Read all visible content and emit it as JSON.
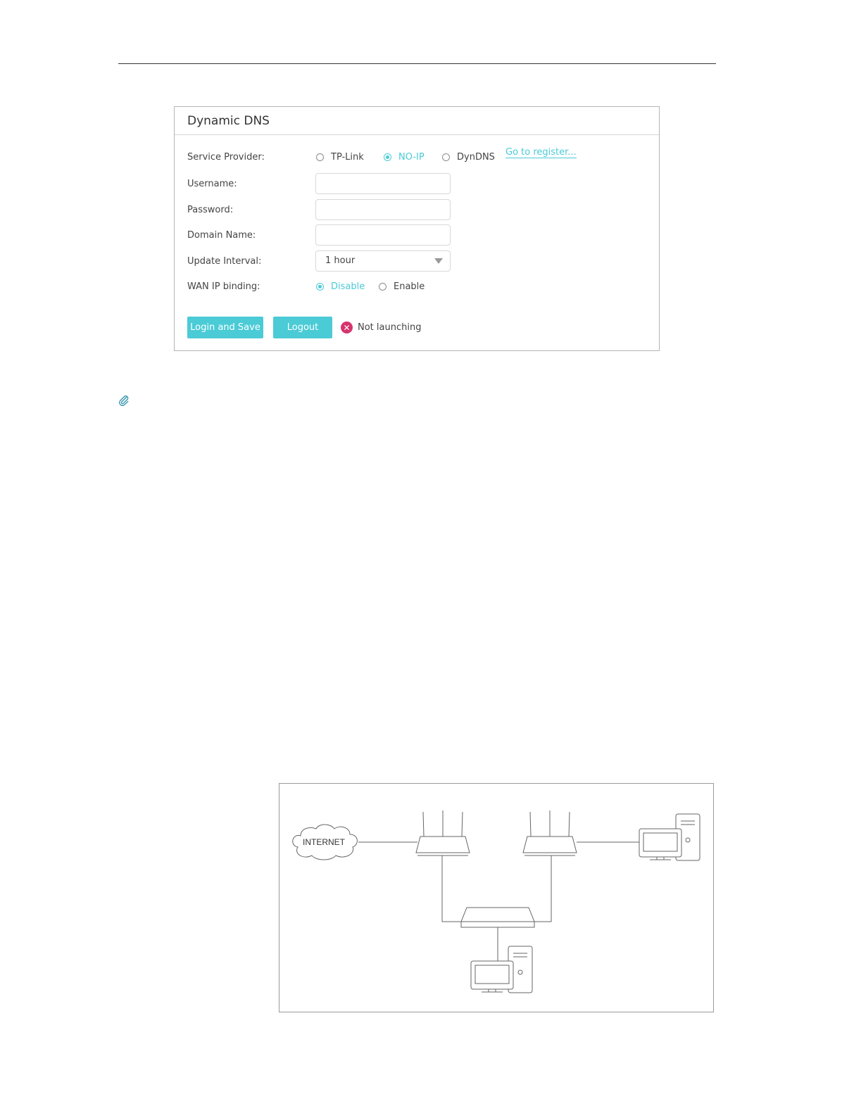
{
  "panel": {
    "title": "Dynamic DNS",
    "service_provider": {
      "label": "Service Provider:",
      "options": [
        "TP-Link",
        "NO-IP",
        "DynDNS"
      ],
      "selected": "NO-IP",
      "register_link": "Go to register..."
    },
    "username": {
      "label": "Username:",
      "value": ""
    },
    "password": {
      "label": "Password:",
      "value": ""
    },
    "domain_name": {
      "label": "Domain Name:",
      "value": ""
    },
    "update_interval": {
      "label": "Update Interval:",
      "value": "1 hour"
    },
    "wan_ip_binding": {
      "label": "WAN IP binding:",
      "options": [
        "Disable",
        "Enable"
      ],
      "selected": "Disable"
    },
    "buttons": {
      "login_save": "Login and Save",
      "logout": "Logout"
    },
    "status": {
      "text": "Not launching",
      "color": "#d6336c"
    },
    "accent_color": "#4acbd6"
  },
  "diagram": {
    "internet_label": "INTERNET"
  }
}
